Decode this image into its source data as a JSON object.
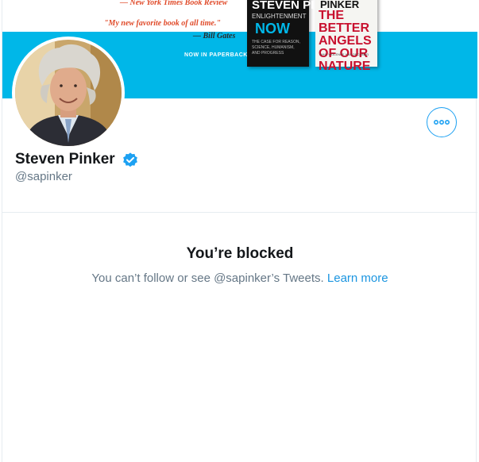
{
  "banner": {
    "quote1": "— New York Times Book Review",
    "quote2": "\"My new favorite book of all time.\"",
    "quote3": "— Bill Gates",
    "paperback_label": "NOW IN PAPERBACK",
    "book1": {
      "author": "STEVEN PINKER",
      "subtitle": "ENLIGHTENMENT",
      "title": "NOW",
      "tagline": "THE CASE FOR REASON, SCIENCE, HUMANISM, AND PROGRESS"
    },
    "book2": {
      "author": "PINKER",
      "title": "THE BETTER ANGELS OF OUR NATURE",
      "tagline": "WHY VIOLENCE HAS DECLINED"
    }
  },
  "profile": {
    "name": "Steven Pinker",
    "handle": "@sapinker"
  },
  "blocked": {
    "title": "You’re blocked",
    "message": "You can’t follow or see @sapinker’s Tweets.",
    "learn_more": "Learn more"
  },
  "colors": {
    "accent": "#1da1f2",
    "banner_cyan": "#00b7e8",
    "text_primary": "#14171a",
    "text_secondary": "#657786"
  }
}
